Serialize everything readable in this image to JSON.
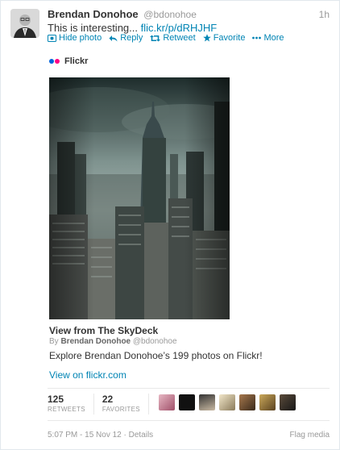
{
  "author": {
    "full_name": "Brendan Donohoe",
    "username": "@bdonohoe"
  },
  "tweet": {
    "timestamp": "1h",
    "text": "This is interesting...",
    "link": "flic.kr/p/dRHJHF"
  },
  "actions": {
    "hide_photo": "Hide photo",
    "reply": "Reply",
    "retweet": "Retweet",
    "favorite": "Favorite",
    "more": "More"
  },
  "card": {
    "provider": "Flickr",
    "title": "View from The SkyDeck",
    "byline_prefix": "By",
    "byline_name": "Brendan Donohoe",
    "byline_username": "@bdonohoe",
    "description": "Explore Brendan Donohoe’s 199 photos on Flickr!",
    "link_text": "View on flickr.com"
  },
  "stats": {
    "retweets_count": "125",
    "retweets_label": "RETWEETS",
    "favorites_count": "22",
    "favorites_label": "FAVORITES"
  },
  "footer": {
    "meta": "5:07 PM - 15 Nov 12 · Details",
    "flag": "Flag media"
  },
  "colors": {
    "link": "#0084b4",
    "flickr_blue": "#0063dc",
    "flickr_pink": "#ff0084"
  }
}
